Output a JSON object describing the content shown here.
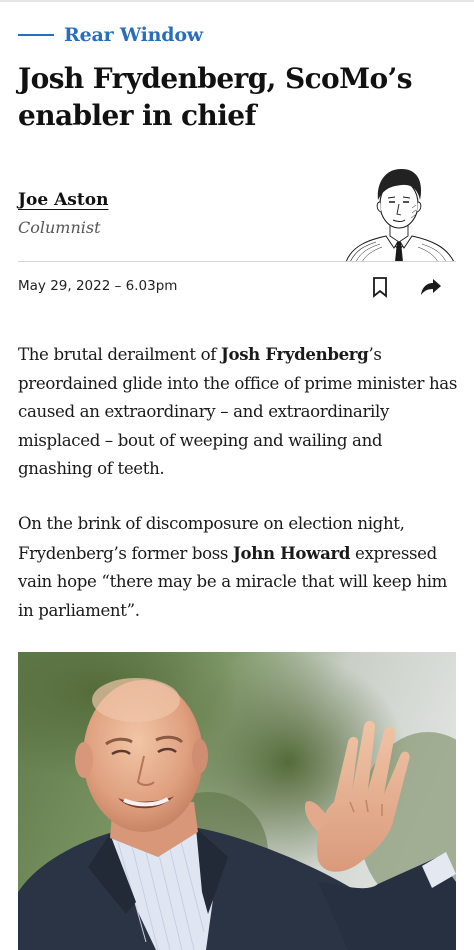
{
  "section": {
    "label": "Rear Window",
    "accent_color": "#2a6ebb"
  },
  "headline": "Josh Frydenberg, ScoMo’s enabler in chief",
  "author": {
    "name": "Joe Aston",
    "role": "Columnist"
  },
  "dateline": "May 29, 2022 – 6.03pm",
  "actions": {
    "bookmark_icon": "bookmark-icon",
    "share_icon": "share-arrow-icon"
  },
  "body": {
    "p1": {
      "t1": "The brutal derailment of ",
      "b1": "Josh Frydenberg",
      "t2": "’s preordained glide into the office of prime minister has caused an extraordinary – and extraordinarily misplaced – bout of weeping and wailing and gnashing of teeth."
    },
    "p2": {
      "t1": "On the brink of discomposure on election night, Frydenberg’s former boss ",
      "b1": "John Howard",
      "t2": " expressed vain hope “there may be a miracle that will keep him in parliament”."
    }
  }
}
